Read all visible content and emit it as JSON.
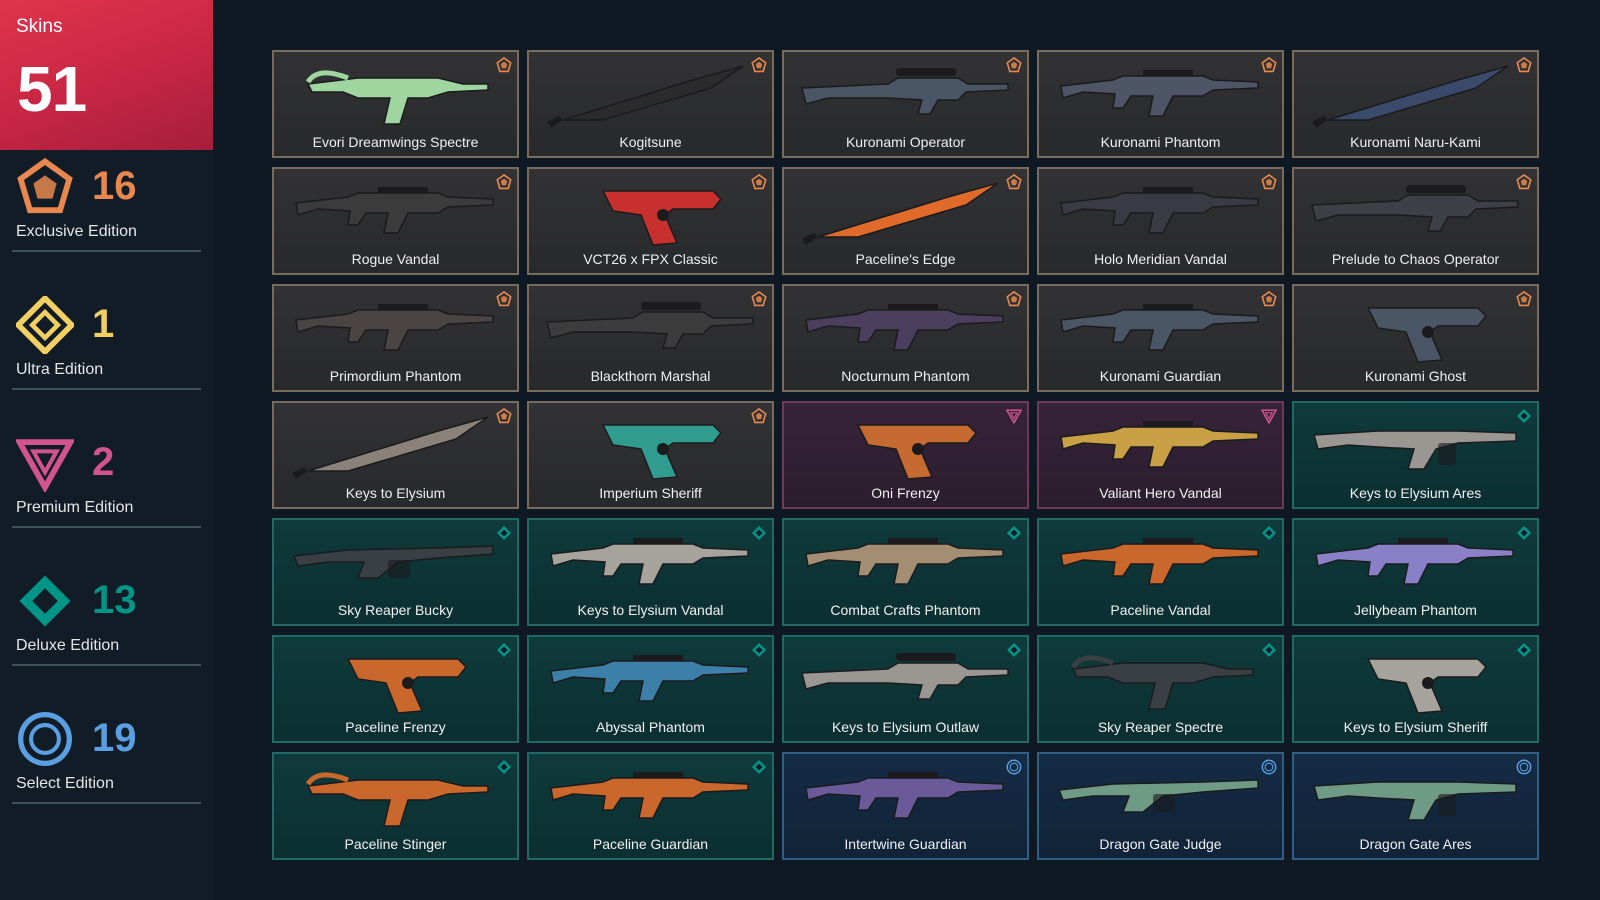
{
  "summary": {
    "label": "Skins",
    "total": "51"
  },
  "tiers": [
    {
      "key": "exclusive",
      "name": "Exclusive Edition",
      "count": "16",
      "color": "#e8884f",
      "icon": "exclusive-pentagon-icon"
    },
    {
      "key": "ultra",
      "name": "Ultra Edition",
      "count": "1",
      "color": "#f2cf63",
      "icon": "ultra-diamond-icon"
    },
    {
      "key": "premium",
      "name": "Premium Edition",
      "count": "2",
      "color": "#d1548e",
      "icon": "premium-triangle-icon"
    },
    {
      "key": "deluxe",
      "name": "Deluxe Edition",
      "count": "13",
      "color": "#009587",
      "icon": "deluxe-rhombus-icon"
    },
    {
      "key": "select",
      "name": "Select Edition",
      "count": "19",
      "color": "#5a9fe2",
      "icon": "select-circle-icon"
    }
  ],
  "skins": [
    {
      "name": "Evori Dreamwings Spectre",
      "tier": "exclusive",
      "weapon": "smg",
      "color": "#9fd6a0"
    },
    {
      "name": "Kogitsune",
      "tier": "exclusive",
      "weapon": "knife",
      "color": "#2b2b2b"
    },
    {
      "name": "Kuronami Operator",
      "tier": "exclusive",
      "weapon": "sniper",
      "color": "#4a5566"
    },
    {
      "name": "Kuronami Phantom",
      "tier": "exclusive",
      "weapon": "rifle",
      "color": "#4d5566"
    },
    {
      "name": "Kuronami Naru-Kami",
      "tier": "exclusive",
      "weapon": "knife",
      "color": "#3a4a6a"
    },
    {
      "name": "Rogue Vandal",
      "tier": "exclusive",
      "weapon": "rifle",
      "color": "#3b3b3b"
    },
    {
      "name": "VCT26 x FPX Classic",
      "tier": "exclusive",
      "weapon": "pistol",
      "color": "#c7302d"
    },
    {
      "name": "Paceline's Edge",
      "tier": "exclusive",
      "weapon": "knife",
      "color": "#e06a2a"
    },
    {
      "name": "Holo Meridian Vandal",
      "tier": "exclusive",
      "weapon": "rifle",
      "color": "#3a3a44"
    },
    {
      "name": "Prelude to Chaos Operator",
      "tier": "exclusive",
      "weapon": "sniper",
      "color": "#3e4048"
    },
    {
      "name": "Primordium Phantom",
      "tier": "exclusive",
      "weapon": "rifle",
      "color": "#4a4542"
    },
    {
      "name": "Blackthorn Marshal",
      "tier": "exclusive",
      "weapon": "sniper",
      "color": "#3c3c3c"
    },
    {
      "name": "Nocturnum Phantom",
      "tier": "exclusive",
      "weapon": "rifle",
      "color": "#4b3e5e"
    },
    {
      "name": "Kuronami Guardian",
      "tier": "exclusive",
      "weapon": "rifle",
      "color": "#4a5566"
    },
    {
      "name": "Kuronami Ghost",
      "tier": "exclusive",
      "weapon": "pistol",
      "color": "#4a5566"
    },
    {
      "name": "Keys to Elysium",
      "tier": "exclusive",
      "weapon": "knife",
      "color": "#8a8279"
    },
    {
      "name": "Imperium Sheriff",
      "tier": "exclusive",
      "weapon": "pistol",
      "color": "#2f9c8f"
    },
    {
      "name": "Oni Frenzy",
      "tier": "premium",
      "weapon": "pistol",
      "color": "#c56a30"
    },
    {
      "name": "Valiant Hero Vandal",
      "tier": "premium",
      "weapon": "rifle",
      "color": "#c9a046"
    },
    {
      "name": "Keys to Elysium Ares",
      "tier": "deluxe",
      "weapon": "lmg",
      "color": "#9a9793"
    },
    {
      "name": "Sky Reaper Bucky",
      "tier": "deluxe",
      "weapon": "shotgun",
      "color": "#3a3f44"
    },
    {
      "name": "Keys to Elysium Vandal",
      "tier": "deluxe",
      "weapon": "rifle",
      "color": "#a6a29c"
    },
    {
      "name": "Combat Crafts Phantom",
      "tier": "deluxe",
      "weapon": "rifle",
      "color": "#a38e73"
    },
    {
      "name": "Paceline Vandal",
      "tier": "deluxe",
      "weapon": "rifle",
      "color": "#c9672d"
    },
    {
      "name": "Jellybeam Phantom",
      "tier": "deluxe",
      "weapon": "rifle",
      "color": "#8a80c8"
    },
    {
      "name": "Paceline Frenzy",
      "tier": "deluxe",
      "weapon": "pistol",
      "color": "#c9672d"
    },
    {
      "name": "Abyssal Phantom",
      "tier": "deluxe",
      "weapon": "rifle",
      "color": "#3c7fa8"
    },
    {
      "name": "Keys to Elysium Outlaw",
      "tier": "deluxe",
      "weapon": "sniper",
      "color": "#9a9793"
    },
    {
      "name": "Sky Reaper Spectre",
      "tier": "deluxe",
      "weapon": "smg",
      "color": "#3a3f44"
    },
    {
      "name": "Keys to Elysium Sheriff",
      "tier": "deluxe",
      "weapon": "pistol",
      "color": "#a6a29c"
    },
    {
      "name": "Paceline Stinger",
      "tier": "deluxe",
      "weapon": "smg",
      "color": "#c9672d"
    },
    {
      "name": "Paceline Guardian",
      "tier": "deluxe",
      "weapon": "rifle",
      "color": "#c9672d"
    },
    {
      "name": "Intertwine Guardian",
      "tier": "select",
      "weapon": "rifle",
      "color": "#6b5a9a"
    },
    {
      "name": "Dragon Gate Judge",
      "tier": "select",
      "weapon": "shotgun",
      "color": "#6f9a86"
    },
    {
      "name": "Dragon Gate Ares",
      "tier": "select",
      "weapon": "lmg",
      "color": "#6f9a86"
    }
  ]
}
